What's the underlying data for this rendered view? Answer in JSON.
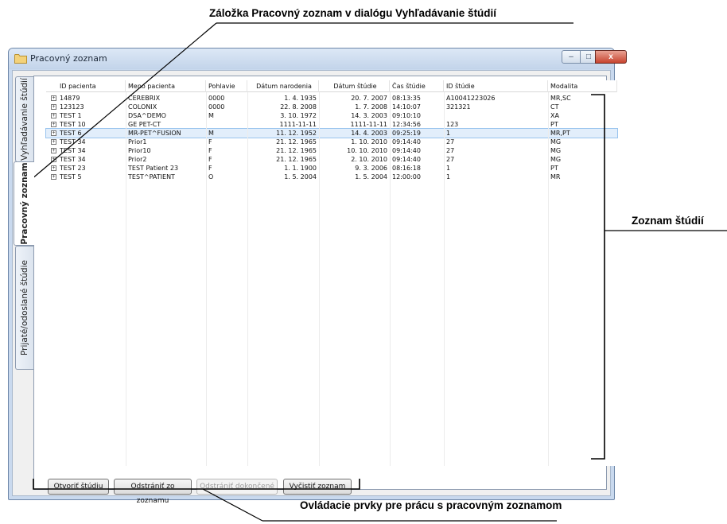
{
  "annotations": {
    "top": "Záložka Pracovný zoznam v dialógu Vyhľadávanie štúdií",
    "right": "Zoznam štúdií",
    "bottom": "Ovládacie prvky pre prácu s pracovným zoznamom"
  },
  "window": {
    "title": "Pracovný zoznam",
    "icon": "folder-icon",
    "controls": {
      "minimize": "–",
      "maximize": "□",
      "close": "x"
    }
  },
  "tabs": [
    {
      "label": "Vyhľadávanie štúdií",
      "active": false
    },
    {
      "label": "Pracovný zoznam",
      "active": true
    },
    {
      "label": "Prijaté/odoslané štúdie",
      "active": false
    }
  ],
  "table": {
    "headers": [
      "ID pacienta",
      "Meno pacienta",
      "Pohlavie",
      "Dátum narodenia",
      "Dátum štúdie",
      "Čas štúdie",
      "ID štúdie",
      "Modalita"
    ],
    "rows": [
      [
        "14879",
        "CEREBRIX",
        "0000",
        "1. 4. 1935",
        "20. 7. 2007",
        "08:13:35",
        "A10041223026",
        "MR,SC"
      ],
      [
        "123123",
        "COLONIX",
        "0000",
        "22. 8. 2008",
        "1. 7. 2008",
        "14:10:07",
        "321321",
        "CT"
      ],
      [
        "TEST 1",
        "DSA^DEMO",
        "M",
        "3. 10. 1972",
        "14. 3. 2003",
        "09:10:10",
        "",
        "XA"
      ],
      [
        "TEST 10",
        "GE PET-CT",
        "",
        "1111-11-11",
        "1111-11-11",
        "12:34:56",
        "123",
        "PT"
      ],
      [
        "TEST 6",
        "MR-PET^FUSION",
        "M",
        "11. 12. 1952",
        "14. 4. 2003",
        "09:25:19",
        "1",
        "MR,PT"
      ],
      [
        "TEST 34",
        "Prior1",
        "F",
        "21. 12. 1965",
        "1. 10. 2010",
        "09:14:40",
        "27",
        "MG"
      ],
      [
        "TEST 34",
        "Prior10",
        "F",
        "21. 12. 1965",
        "10. 10. 2010",
        "09:14:40",
        "27",
        "MG"
      ],
      [
        "TEST 34",
        "Prior2",
        "F",
        "21. 12. 1965",
        "2. 10. 2010",
        "09:14:40",
        "27",
        "MG"
      ],
      [
        "TEST 23",
        "TEST Patient 23",
        "F",
        "1. 1. 1900",
        "9. 3. 2006",
        "08:16:18",
        "1",
        "PT"
      ],
      [
        "TEST 5",
        "TEST^PATIENT",
        "O",
        "1. 5. 2004",
        "1. 5. 2004",
        "12:00:00",
        "1",
        "MR"
      ]
    ],
    "selected_row": 4,
    "expander_symbol": "+"
  },
  "buttons": {
    "open": "Otvoriť štúdiu",
    "remove": "Odstrániť zo zoznamu",
    "remove_done": "Odstrániť dokončené",
    "clear": "Vyčistiť zoznam"
  },
  "colors": {
    "selection": "#e2eefb",
    "window_frame": "#c9d9ee",
    "close_button": "#c8442f"
  }
}
